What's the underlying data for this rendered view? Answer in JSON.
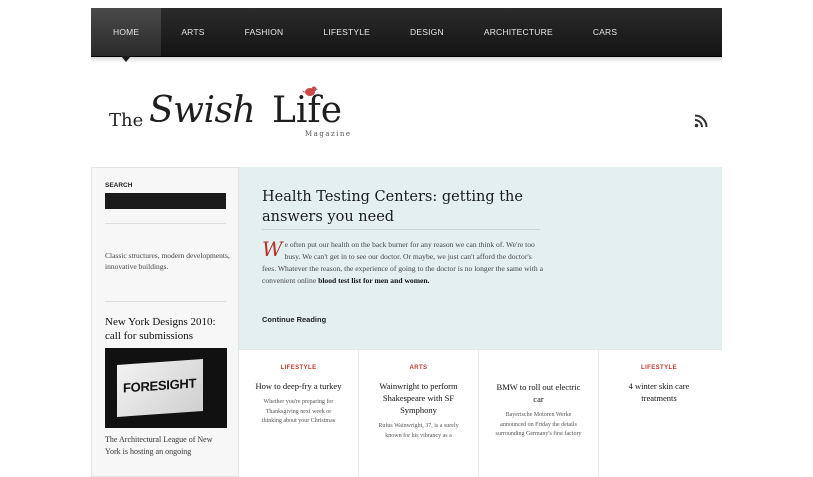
{
  "nav": {
    "items": [
      "HOME",
      "ARTS",
      "FASHION",
      "LIFESTYLE",
      "DESIGN",
      "ARCHITECTURE",
      "CARS"
    ]
  },
  "logo": {
    "the": "The",
    "swish": "Swish",
    "life": "Life",
    "magazine": "Magazine"
  },
  "sidebar": {
    "search_label": "SEARCH",
    "search_value": "",
    "blurb": "Classic structures, modern developments, innovative buildings.",
    "post_title": "New York Designs 2010: call for submissions",
    "image_text": "FORESIGHT",
    "caption": "The Architectural League of New York is hosting an ongoing"
  },
  "featured": {
    "title": "Health Testing Centers: getting the answers you need",
    "dropcap": "W",
    "body": "e often put our health on the back burner for any reason we can think of. We're too busy. We can't get in to see our doctor. Or maybe, we just can't afford the doctor's fees. Whatever the reason, the experience of going to the doctor is no longer the same with a convenient online ",
    "body_link": "blood test list for men and women.",
    "continue_label": "Continue Reading"
  },
  "cards": [
    {
      "category": "LIFESTYLE",
      "title": "How to deep-fry a turkey",
      "excerpt": "Whether you're preparing for Thanksgiving next week or thinking about your Christmas"
    },
    {
      "category": "ARTS",
      "title": "Wainwright to perform Shakespeare with SF Symphony",
      "excerpt": "Rufus Wainwright, 37, is a surely known for his vibrancy as a"
    },
    {
      "category": "",
      "title": "BMW to roll out electric car",
      "excerpt": "Bayerische Motoren Werke announced on Friday the details surrounding Germany's first factory"
    },
    {
      "category": "LIFESTYLE",
      "title": "4 winter skin care treatments",
      "excerpt": ""
    }
  ],
  "colors": {
    "nav_bg": "#1a1a1a",
    "featured_bg": "#e4f0f0",
    "accent_red": "#c0392b"
  }
}
